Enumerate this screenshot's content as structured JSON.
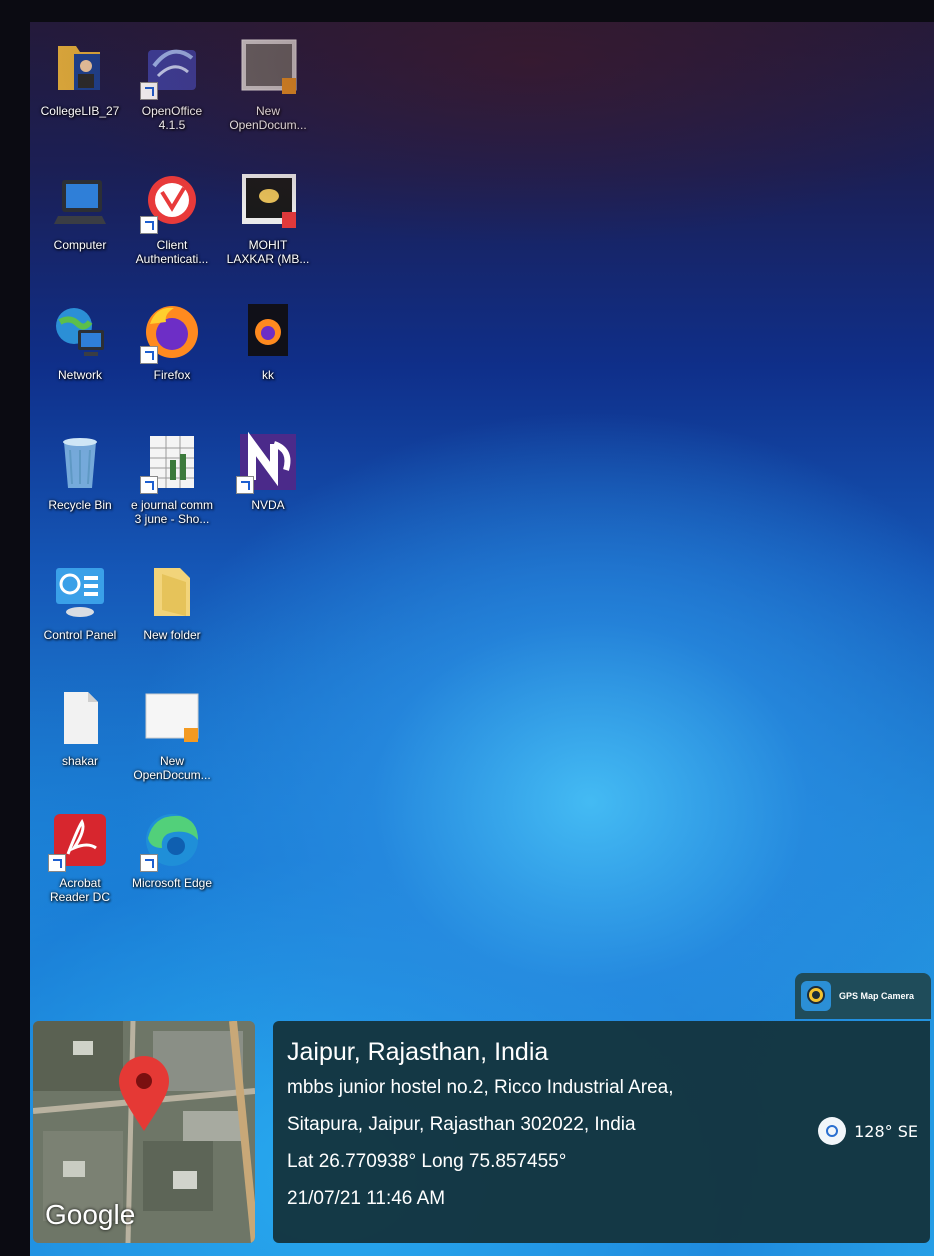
{
  "desktop_icons": [
    {
      "label": "CollegeLIB_27",
      "icon": "folder-user-icon"
    },
    {
      "label": "OpenOffice\n4.1.5",
      "icon": "openoffice-icon"
    },
    {
      "label": "New\nOpenDocum...",
      "icon": "document-icon"
    },
    {
      "label": "Computer",
      "icon": "computer-icon"
    },
    {
      "label": "Client\nAuthenticati...",
      "icon": "client-auth-icon"
    },
    {
      "label": "MOHIT\nLAXKAR (MB...",
      "icon": "image-file-icon"
    },
    {
      "label": "Network",
      "icon": "network-icon"
    },
    {
      "label": "Firefox",
      "icon": "firefox-icon"
    },
    {
      "label": "kk",
      "icon": "firefox-file-icon"
    },
    {
      "label": "Recycle Bin",
      "icon": "recycle-bin-icon"
    },
    {
      "label": "e journal comm\n3 june - Sho...",
      "icon": "spreadsheet-icon"
    },
    {
      "label": "NVDA",
      "icon": "nvda-icon"
    },
    {
      "label": "Control Panel",
      "icon": "control-panel-icon"
    },
    {
      "label": "New folder",
      "icon": "folder-icon"
    },
    {
      "label": "shakar",
      "icon": "text-file-icon"
    },
    {
      "label": "New\nOpenDocum...",
      "icon": "document-icon"
    },
    {
      "label": "Acrobat\nReader DC",
      "icon": "acrobat-icon"
    },
    {
      "label": "Microsoft Edge",
      "icon": "edge-icon"
    }
  ],
  "gps_overlay": {
    "app_name": "GPS Map Camera",
    "map_brand": "Google",
    "city": "Jaipur, Rajasthan, India",
    "address_line1": "mbbs junior hostel no.2, Ricco Industrial Area,",
    "address_line2": "Sitapura, Jaipur, Rajasthan 302022, India",
    "coordinates": "Lat 26.770938° Long 75.857455°",
    "datetime": "21/07/21 11:46 AM",
    "heading": "128° SE"
  },
  "colors": {
    "overlay_bg": "#14343e",
    "pin_red": "#e53935",
    "desktop_blue": "#1e86d6"
  }
}
